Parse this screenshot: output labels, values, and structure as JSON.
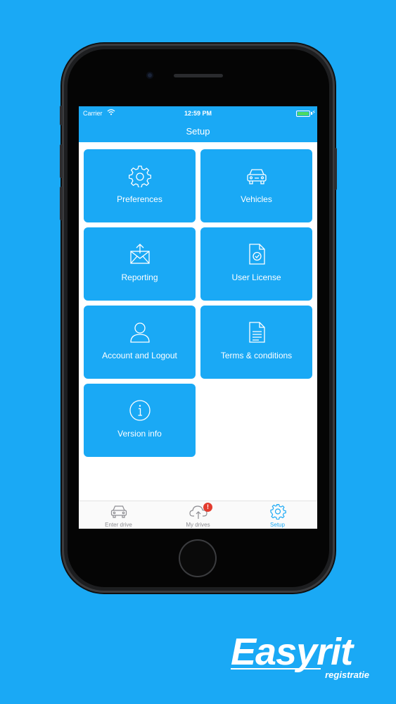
{
  "status_bar": {
    "carrier": "Carrier",
    "time": "12:59 PM"
  },
  "header": {
    "title": "Setup"
  },
  "tiles": [
    {
      "label": "Preferences",
      "icon": "gear-icon"
    },
    {
      "label": "Vehicles",
      "icon": "car-icon"
    },
    {
      "label": "Reporting",
      "icon": "envelope-upload-icon"
    },
    {
      "label": "User License",
      "icon": "document-check-icon"
    },
    {
      "label": "Account and Logout",
      "icon": "user-icon"
    },
    {
      "label": "Terms & conditions",
      "icon": "document-lines-icon"
    },
    {
      "label": "Version info",
      "icon": "info-icon"
    }
  ],
  "tabbar": {
    "items": [
      {
        "label": "Enter drive",
        "icon": "car-icon"
      },
      {
        "label": "My drives",
        "icon": "cloud-upload-icon",
        "badge": "!"
      },
      {
        "label": "Setup",
        "icon": "gear-icon",
        "active": true
      }
    ]
  },
  "brand": {
    "name": "Easyrit",
    "subtitle": "registratie"
  },
  "colors": {
    "accent": "#1aa9f5",
    "badge": "#e23b2e",
    "battery": "#4cd964",
    "tab_inactive": "#8e8e93"
  }
}
